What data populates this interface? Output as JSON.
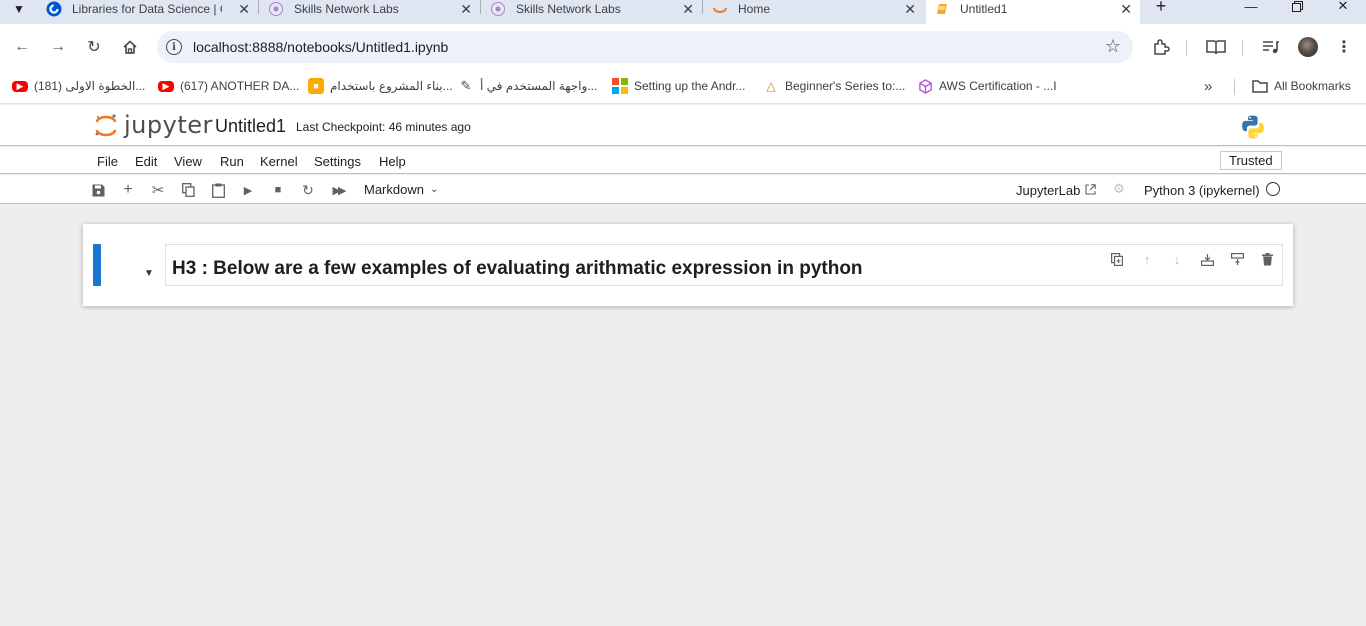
{
  "browser": {
    "tabs": [
      {
        "title": "Libraries for Data Science | C",
        "icon": "coursera-icon"
      },
      {
        "title": "Skills Network Labs",
        "icon": "skills-network-icon"
      },
      {
        "title": "Skills Network Labs",
        "icon": "skills-network-icon"
      },
      {
        "title": "Home",
        "icon": "jupyter-icon"
      },
      {
        "title": "Untitled1",
        "icon": "notebook-icon"
      }
    ],
    "active_tab_index": 4,
    "url": "localhost:8888/notebooks/Untitled1.ipynb",
    "bookmarks": [
      {
        "label": "(181) الخطوة الاولى...",
        "icon": "youtube-icon"
      },
      {
        "label": "(617) ANOTHER DA...",
        "icon": "youtube-icon"
      },
      {
        "label": "بناء المشروع باستخدام...",
        "icon": "monitor-icon"
      },
      {
        "label": "واجهة المستخدم في أ...",
        "icon": "document-icon"
      },
      {
        "label": "Setting up the Andr...",
        "icon": "microsoft-icon"
      },
      {
        "label": "Beginner's Series to:...",
        "icon": "learn-icon"
      },
      {
        "label": "AWS Certification - ...I",
        "icon": "cube-icon"
      }
    ],
    "more_bookmarks": "»",
    "all_bookmarks_label": "All Bookmarks"
  },
  "jupyter": {
    "logo_text": "jupyter",
    "notebook_title": "Untitled1",
    "checkpoint": "Last Checkpoint: 46 minutes ago",
    "menu": [
      "File",
      "Edit",
      "View",
      "Run",
      "Kernel",
      "Settings",
      "Help"
    ],
    "trusted_label": "Trusted",
    "cell_type": "Markdown",
    "jupyterlab_label": "JupyterLab",
    "kernel_name": "Python 3 (ipykernel)"
  },
  "cells": [
    {
      "type": "markdown",
      "text": "H3 : Below are a few examples of evaluating arithmatic expression in python"
    }
  ],
  "colors": {
    "tabstrip_bg": "#dfe5f1",
    "active_cell_bar": "#1976d2",
    "notebook_bg": "#eeeeee",
    "jupyter_orange": "#f37726"
  }
}
